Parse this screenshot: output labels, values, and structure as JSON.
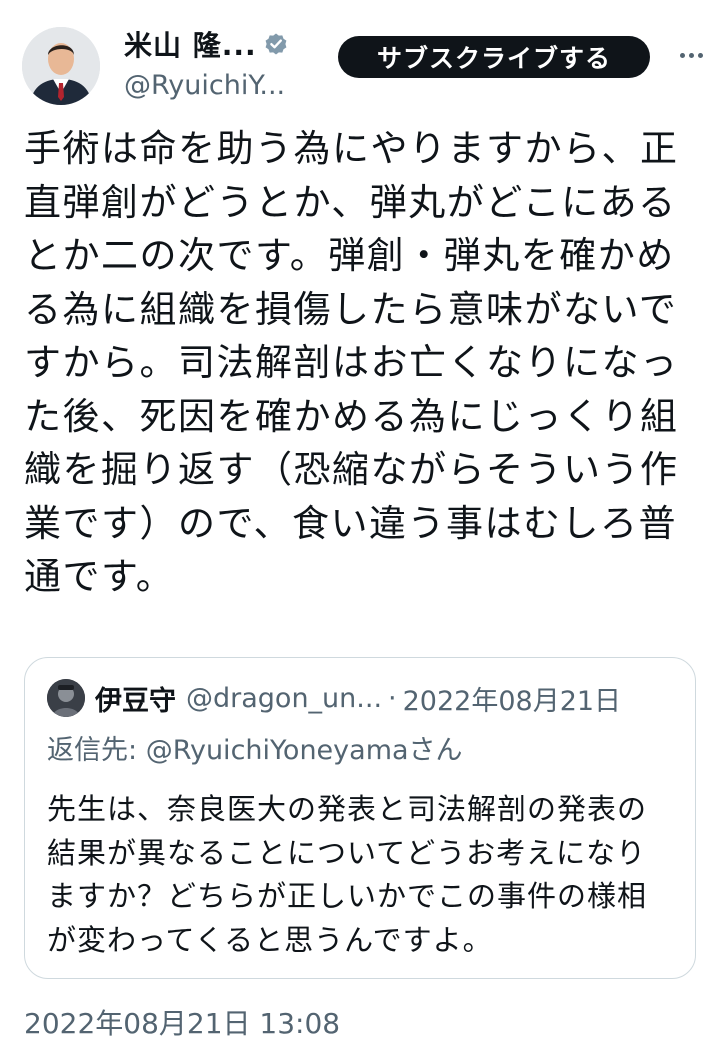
{
  "author": {
    "display_name": "米山 隆...",
    "handle": "@RyuichiY...",
    "verified": true
  },
  "actions": {
    "subscribe_label": "サブスクライブする"
  },
  "tweet": {
    "text": "手術は命を助う為にやりますから、正直弾創がどうとか、弾丸がどこにあるとか二の次です。弾創・弾丸を確かめる為に組織を損傷したら意味がないですから。司法解剖はお亡くなりになった後、死因を確かめる為にじっくり組織を掘り返す（恐縮ながらそういう作業です）ので、食い違う事はむしろ普通です。",
    "timestamp": "2022年08月21日 13:08"
  },
  "quoted_tweet": {
    "display_name": "伊豆守",
    "handle": "@dragon_un...",
    "separator": "·",
    "date": "2022年08月21日",
    "reply_prefix": "返信先: ",
    "reply_to": "@RyuichiYoneyama",
    "reply_suffix": "さん",
    "text": "先生は、奈良医大の発表と司法解剖の発表の結果が異なることについてどうお考えになりますか？どちらが正しいかでこの事件の様相が変わってくると思うんですよ。"
  },
  "colors": {
    "text_primary": "#0f1419",
    "text_secondary": "#536471",
    "verified_badge": "#829aab",
    "button_bg": "#0f1419",
    "border": "#cfd9de"
  },
  "icons": {
    "verified": "verified-badge-icon",
    "more": "more-options-icon"
  }
}
